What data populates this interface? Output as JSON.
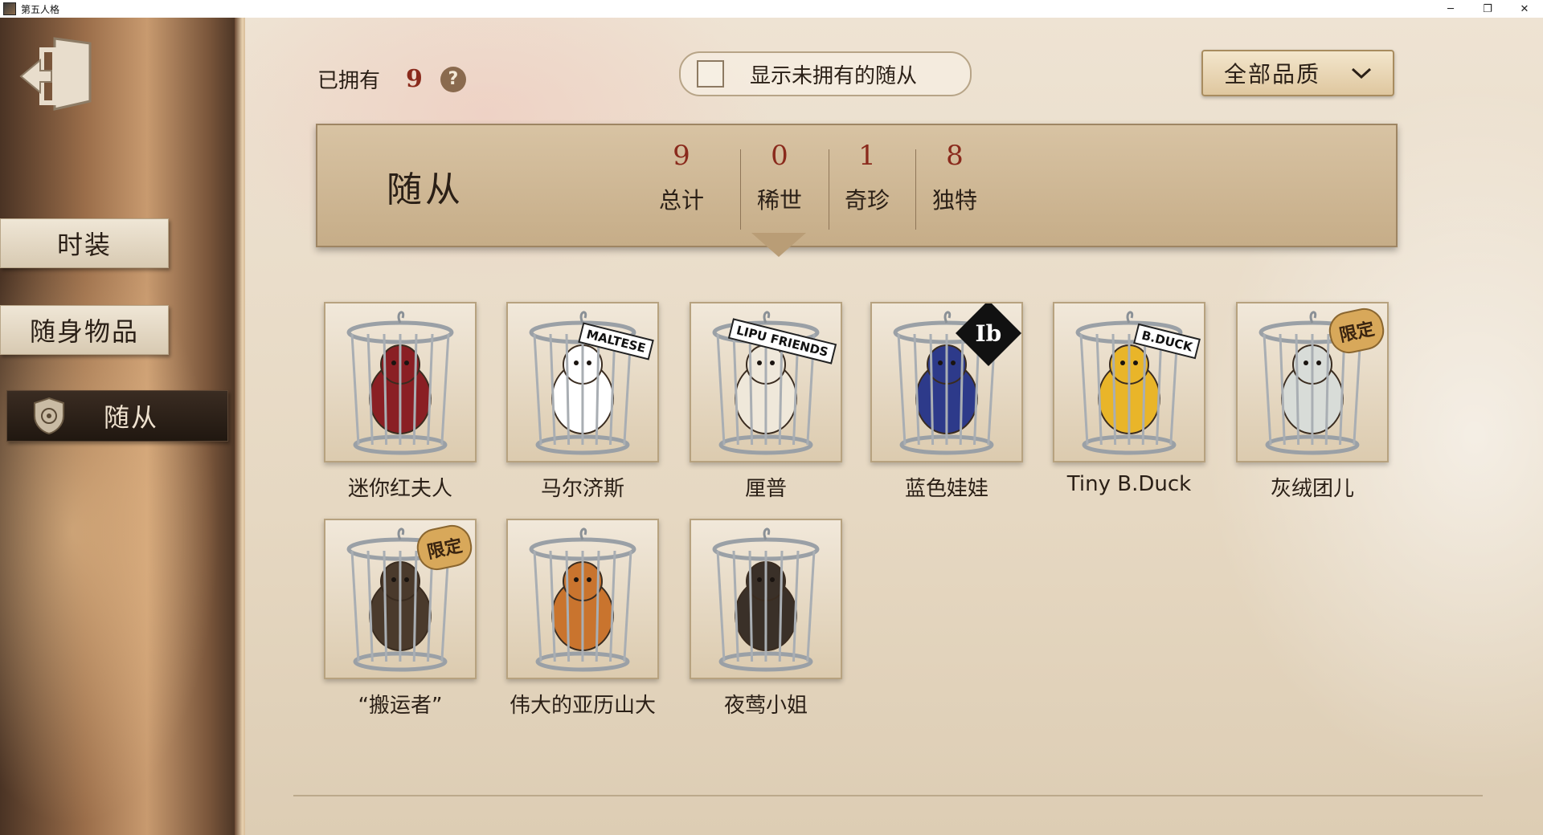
{
  "window": {
    "title": "第五人格",
    "controls": [
      "─",
      "❐",
      "✕"
    ]
  },
  "sidebar": {
    "items": [
      {
        "label": "时装"
      },
      {
        "label": "随身物品"
      },
      {
        "label": "随从"
      }
    ]
  },
  "toolbar": {
    "owned_label": "已拥有",
    "owned_count": "9",
    "help": "?",
    "show_unowned_label": "显示未拥有的随从",
    "quality_filter": "全部品质"
  },
  "banner": {
    "title": "随从",
    "stats": [
      {
        "value": "9",
        "label": "总计"
      },
      {
        "value": "0",
        "label": "稀世"
      },
      {
        "value": "1",
        "label": "奇珍"
      },
      {
        "value": "8",
        "label": "独特"
      }
    ]
  },
  "pets": [
    {
      "name": "迷你红夫人",
      "color": "#8a1f24"
    },
    {
      "name": "马尔济斯",
      "color": "#ffffff",
      "tag": "MALTESE"
    },
    {
      "name": "厘普",
      "color": "#efe8da",
      "tag": "LIPU FRIENDS"
    },
    {
      "name": "蓝色娃娃",
      "color": "#2d3a8a",
      "badge": "Ib"
    },
    {
      "name": "Tiny B.Duck",
      "color": "#e9b529",
      "tag": "B.DUCK"
    },
    {
      "name": "灰绒团儿",
      "color": "#d8dcd8",
      "badge": "限定"
    },
    {
      "name": "“搬运者”",
      "color": "#4a3a2c",
      "badge": "限定"
    },
    {
      "name": "伟大的亚历山大",
      "color": "#c9742e"
    },
    {
      "name": "夜莺小姐",
      "color": "#3a3028"
    }
  ]
}
